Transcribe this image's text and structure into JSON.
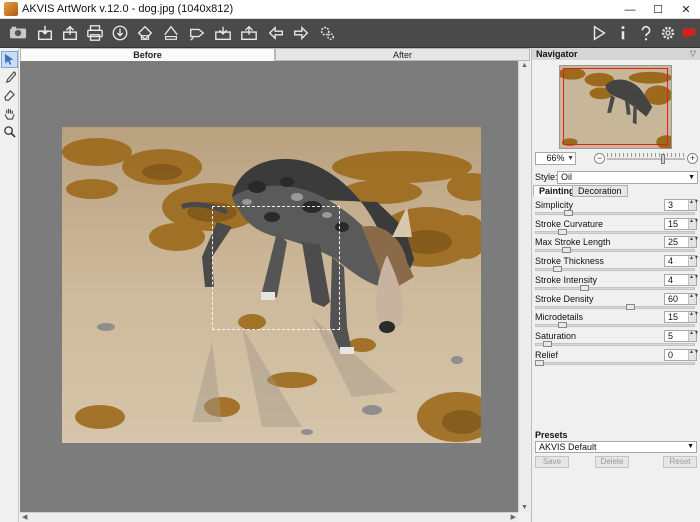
{
  "window": {
    "title": "AKVIS ArtWork v.12.0 - dog.jpg (1040x812)",
    "controls": [
      "—",
      "☐",
      "✕"
    ]
  },
  "toolbar": {
    "left_icons": [
      "open-icon",
      "save-icon",
      "print-icon",
      "share-icon",
      "batch-icon",
      "export-icon",
      "import-icon",
      "settings-effects-icon",
      "paste-icon",
      "clipboard-icon",
      "undo-icon",
      "redo-icon",
      "plugin-icon"
    ],
    "right_icons": [
      "run-icon",
      "info-icon",
      "help-icon",
      "gear-icon",
      "feedback-icon"
    ],
    "accent_color": "#d62020"
  },
  "tools": [
    "select-tool-icon",
    "brush-tool-icon",
    "eraser-tool-icon",
    "hand-tool-icon",
    "zoom-tool-icon"
  ],
  "view_tabs": {
    "before": "Before",
    "after": "After"
  },
  "navigator": {
    "title": "Navigator",
    "zoom": "66%",
    "style_label": "Style:",
    "style_value": "Oil"
  },
  "painting_tabs": {
    "painting": "Painting",
    "decoration": "Decoration"
  },
  "params": [
    {
      "name": "Simplicity",
      "value": "3",
      "level": 0.19
    },
    {
      "name": "Stroke Curvature",
      "value": "15",
      "level": 0.15
    },
    {
      "name": "Max Stroke Length",
      "value": "25",
      "level": 0.18
    },
    {
      "name": "Stroke Thickness",
      "value": "4",
      "level": 0.12
    },
    {
      "name": "Stroke Intensity",
      "value": "4",
      "level": 0.3
    },
    {
      "name": "Stroke Density",
      "value": "60",
      "level": 0.6
    },
    {
      "name": "Microdetails",
      "value": "15",
      "level": 0.15
    },
    {
      "name": "Saturation",
      "value": "5",
      "level": 0.05
    },
    {
      "name": "Relief",
      "value": "0",
      "level": 0.0
    }
  ],
  "presets": {
    "title": "Presets",
    "selected": "AKVIS Default",
    "save": "Save",
    "delete": "Delete",
    "reset": "Reset"
  }
}
